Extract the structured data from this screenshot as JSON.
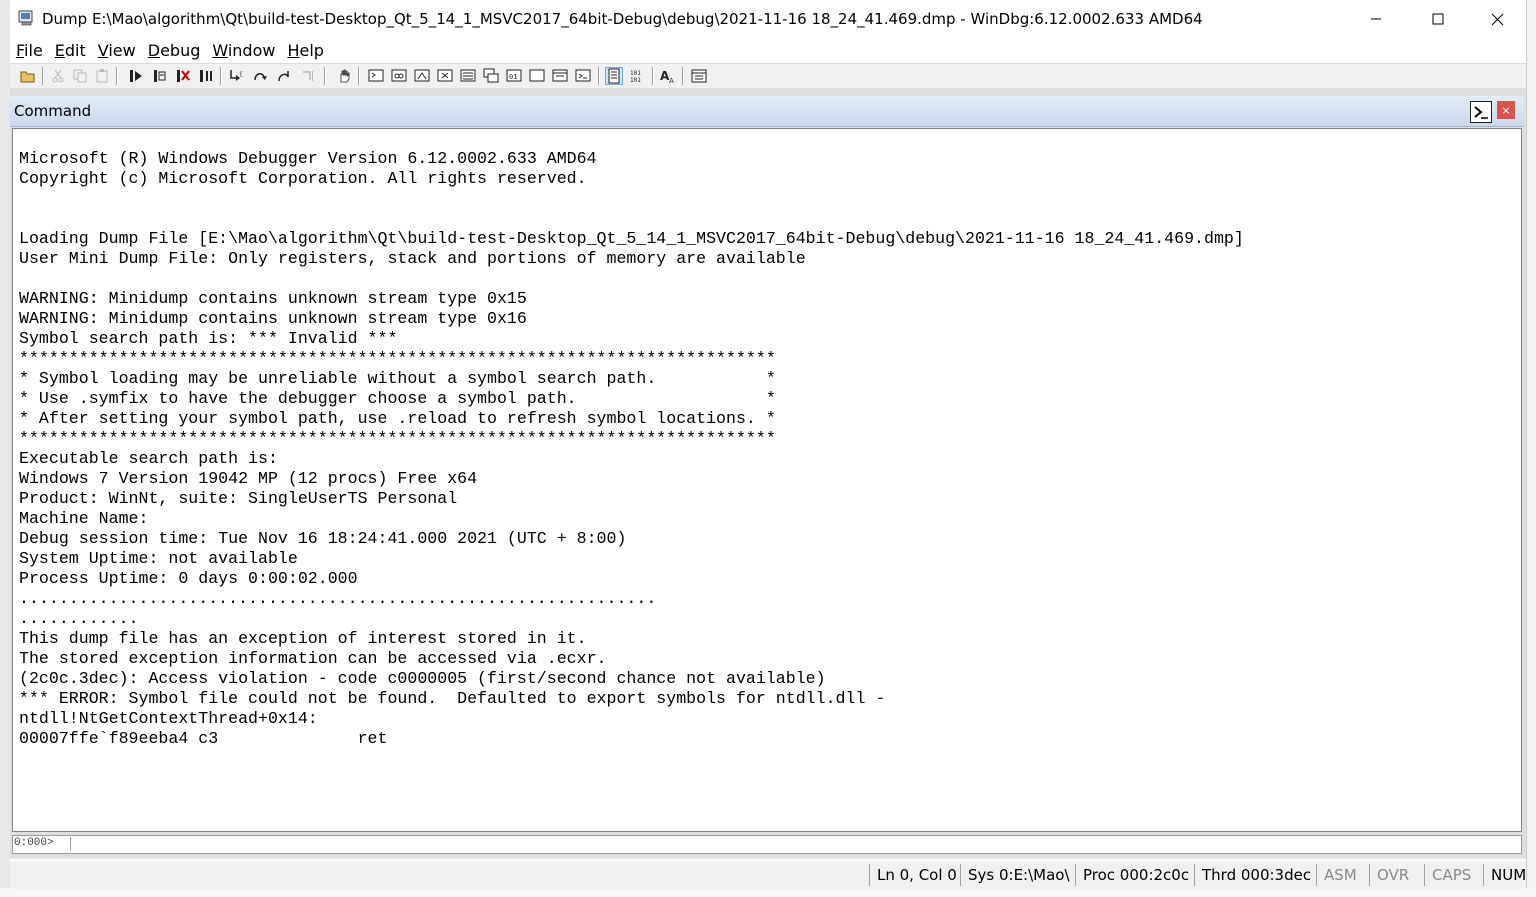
{
  "window": {
    "title": "Dump E:\\Mao\\algorithm\\Qt\\build-test-Desktop_Qt_5_14_1_MSVC2017_64bit-Debug\\debug\\2021-11-16 18_24_41.469.dmp - WinDbg:6.12.0002.633 AMD64",
    "minimize_icon": "minimize-icon",
    "maximize_icon": "maximize-icon",
    "close_icon": "close-icon"
  },
  "menubar": {
    "items": [
      {
        "label": "File",
        "mnemonic": "F",
        "rest": "ile"
      },
      {
        "label": "Edit",
        "mnemonic": "E",
        "rest": "dit"
      },
      {
        "label": "View",
        "mnemonic": "V",
        "rest": "iew"
      },
      {
        "label": "Debug",
        "mnemonic": "D",
        "rest": "ebug"
      },
      {
        "label": "Window",
        "mnemonic": "W",
        "rest": "indow"
      },
      {
        "label": "Help",
        "mnemonic": "H",
        "rest": "elp"
      }
    ]
  },
  "toolbar": {
    "icons": [
      "open-folder-icon",
      "cut-icon",
      "copy-icon",
      "paste-icon",
      "go-icon",
      "restart-icon",
      "stop-debugging-icon",
      "break-icon",
      "step-into-icon",
      "step-over-icon",
      "step-out-icon",
      "run-to-cursor-icon",
      "hand-icon",
      "command-window-icon",
      "watch-window-icon",
      "locals-window-icon",
      "registers-window-icon",
      "memory-window-icon",
      "call-stack-icon",
      "disassembly-window-icon",
      "scratch-pad-icon",
      "processes-threads-icon",
      "source-mode-icon",
      "hex-mode-icon",
      "font-icon",
      "options-icon"
    ]
  },
  "command_window": {
    "title": "Command",
    "icon": "command-prompt-icon",
    "close_label": "×",
    "output_lines": [
      "Microsoft (R) Windows Debugger Version 6.12.0002.633 AMD64",
      "Copyright (c) Microsoft Corporation. All rights reserved.",
      "",
      "",
      "Loading Dump File [E:\\Mao\\algorithm\\Qt\\build-test-Desktop_Qt_5_14_1_MSVC2017_64bit-Debug\\debug\\2021-11-16 18_24_41.469.dmp]",
      "User Mini Dump File: Only registers, stack and portions of memory are available",
      "",
      "WARNING: Minidump contains unknown stream type 0x15",
      "WARNING: Minidump contains unknown stream type 0x16",
      "Symbol search path is: *** Invalid ***",
      "****************************************************************************",
      "* Symbol loading may be unreliable without a symbol search path.           *",
      "* Use .symfix to have the debugger choose a symbol path.                   *",
      "* After setting your symbol path, use .reload to refresh symbol locations. *",
      "****************************************************************************",
      "Executable search path is:",
      "Windows 7 Version 19042 MP (12 procs) Free x64",
      "Product: WinNt, suite: SingleUserTS Personal",
      "Machine Name:",
      "Debug session time: Tue Nov 16 18:24:41.000 2021 (UTC + 8:00)",
      "System Uptime: not available",
      "Process Uptime: 0 days 0:00:02.000",
      "................................................................",
      "............",
      "This dump file has an exception of interest stored in it.",
      "The stored exception information can be accessed via .ecxr.",
      "(2c0c.3dec): Access violation - code c0000005 (first/second chance not available)",
      "*** ERROR: Symbol file could not be found.  Defaulted to export symbols for ntdll.dll -",
      "ntdll!NtGetContextThread+0x14:",
      "00007ffe`f89eeba4 c3              ret"
    ],
    "prompt": "0:000>",
    "input_value": ""
  },
  "statusbar": {
    "position": "Ln 0, Col 0",
    "sys": "Sys 0:E:\\Mao\\",
    "proc": "Proc 000:2c0c",
    "thrd": "Thrd 000:3dec",
    "asm": "ASM",
    "ovr": "OVR",
    "caps": "CAPS",
    "num": "NUM"
  },
  "colors": {
    "command_header_top": "#e3ecf7",
    "command_header_bottom": "#c9d8ec",
    "close_button": "#d9534f",
    "status_dim": "#8a8a8a"
  }
}
